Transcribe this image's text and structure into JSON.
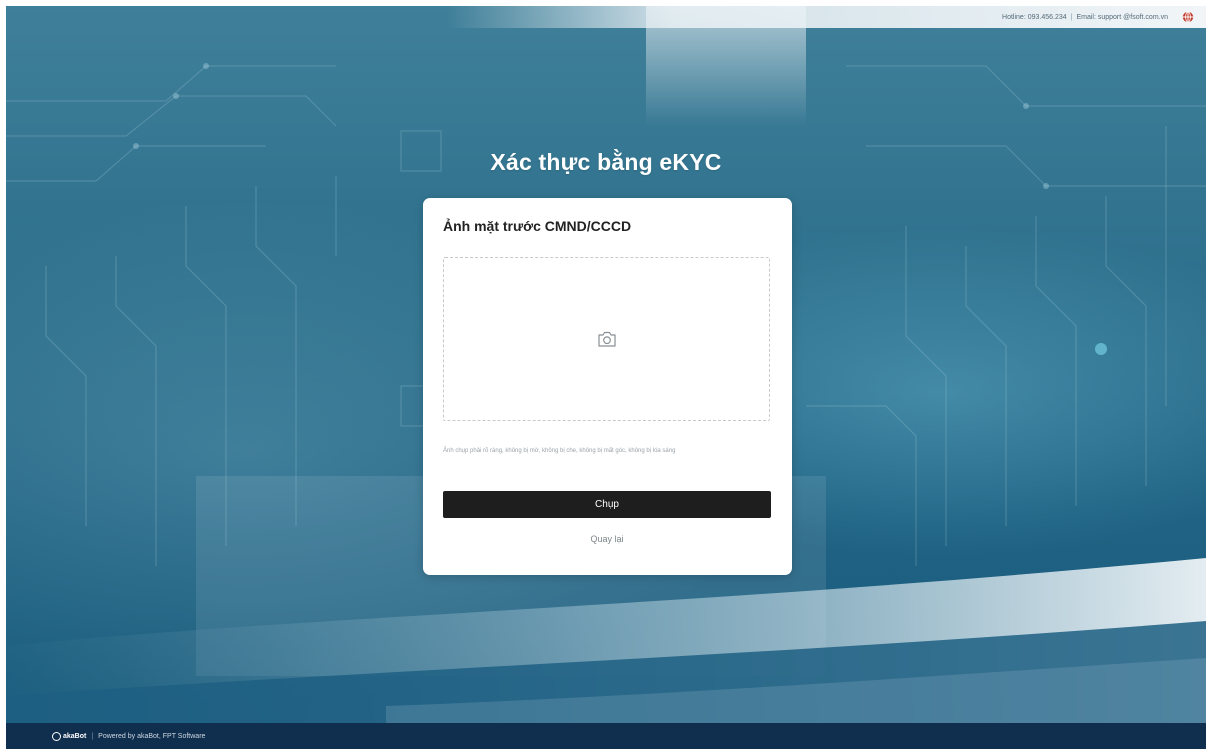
{
  "topbar": {
    "hotline": "Hotline: 093.456.234",
    "separator": "|",
    "email": "Email: support @fsoft.com.vn"
  },
  "page": {
    "title": "Xác thực bằng eKYC"
  },
  "card": {
    "title": "Ảnh mặt trước CMND/CCCD",
    "hint": "Ảnh chụp phải rõ ràng, không bị mờ, không bị che, không bị mất góc, không bị lóa sáng",
    "capture_label": "Chụp",
    "back_label": "Quay lại"
  },
  "footer": {
    "logo_text": "akaBot",
    "separator": "|",
    "powered_by": "Powered by akaBot, FPT Software"
  },
  "icons": {
    "camera": "camera-icon",
    "globe": "globe-icon",
    "logo": "akabot-logo-icon"
  },
  "colors": {
    "background": "#2c6f8c",
    "card": "#ffffff",
    "primary_button": "#1e1e1e",
    "footer": "#102f4e"
  }
}
